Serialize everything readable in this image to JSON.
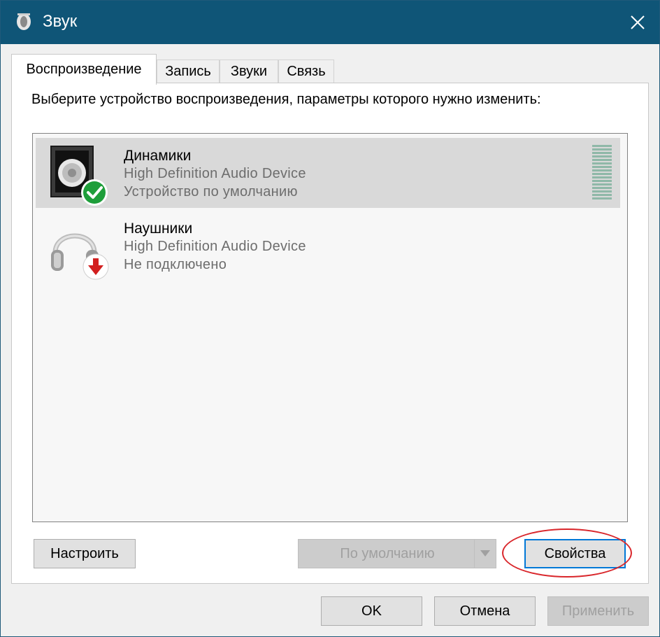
{
  "window": {
    "title": "Звук",
    "title_bar_color": "#0f5577"
  },
  "tabs": [
    {
      "label": "Воспроизведение",
      "active": true
    },
    {
      "label": "Запись",
      "active": false
    },
    {
      "label": "Звуки",
      "active": false
    },
    {
      "label": "Связь",
      "active": false
    }
  ],
  "panel": {
    "instruction": "Выберите устройство воспроизведения, параметры которого нужно изменить:"
  },
  "devices": [
    {
      "name": "Динамики",
      "driver": "High Definition Audio Device",
      "status": "Устройство по умолчанию",
      "icon": "speaker-icon",
      "badge": "check-badge-icon",
      "selected": true
    },
    {
      "name": "Наушники",
      "driver": "High Definition Audio Device",
      "status": "Не подключено",
      "icon": "headphones-icon",
      "badge": "down-arrow-badge-icon",
      "selected": false
    }
  ],
  "buttons": {
    "configure": "Настроить",
    "set_default": "По умолчанию",
    "properties": "Свойства",
    "ok": "OK",
    "cancel": "Отмена",
    "apply": "Применить"
  },
  "colors": {
    "accent": "#0078d7",
    "highlight": "#d9262b",
    "check_green": "#1e9e3a",
    "arrow_red": "#d21f1f"
  }
}
